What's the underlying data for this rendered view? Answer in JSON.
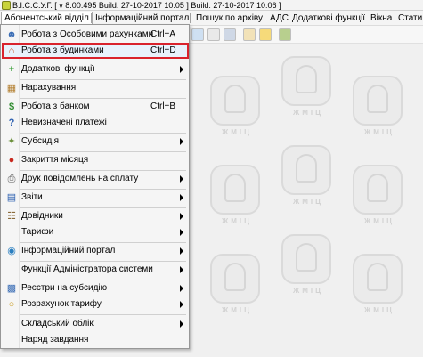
{
  "window": {
    "title": "В.І.С.С.У.Г. [ v 8.00.495 Build: 27-10-2017 10:05 ]   Build: 27-10-2017 10:06 ]"
  },
  "menubar": {
    "items": [
      {
        "label": "Абонентський відділ"
      },
      {
        "label": "Інформаційний портал"
      },
      {
        "label": "Пошук по архіву"
      },
      {
        "label": "АДС"
      },
      {
        "label": "Додаткові функції"
      },
      {
        "label": "Вікна"
      },
      {
        "label": "Стати"
      }
    ]
  },
  "watermark": {
    "text": "ЖМІЦ"
  },
  "dropdown": {
    "items": [
      {
        "label": "Робота з Особовими рахунками",
        "shortcut": "Ctrl+A",
        "icon": "user-accounts-icon",
        "submenu": false
      },
      {
        "label": "Робота з будинками",
        "shortcut": "Ctrl+D",
        "icon": "house-icon",
        "submenu": false
      },
      {
        "label": "Додаткові функції",
        "shortcut": "",
        "icon": "plus-icon",
        "submenu": true
      },
      {
        "label": "Нарахування",
        "shortcut": "",
        "icon": "calculator-icon",
        "submenu": false
      },
      {
        "label": "Робота з банком",
        "shortcut": "Ctrl+B",
        "icon": "dollar-icon",
        "submenu": false
      },
      {
        "label": "Невизначені платежі",
        "shortcut": "",
        "icon": "question-icon",
        "submenu": false
      },
      {
        "label": "Субсидія",
        "shortcut": "",
        "icon": "subsidy-icon",
        "submenu": true
      },
      {
        "label": "Закриття місяця",
        "shortcut": "",
        "icon": "stop-icon",
        "submenu": false
      },
      {
        "label": "Друк повідомлень на сплату",
        "shortcut": "",
        "icon": "printer-icon",
        "submenu": true
      },
      {
        "label": "Звіти",
        "shortcut": "",
        "icon": "report-icon",
        "submenu": true
      },
      {
        "label": "Довідники",
        "shortcut": "",
        "icon": "reference-icon",
        "submenu": true
      },
      {
        "label": "Тарифи",
        "shortcut": "",
        "icon": "",
        "submenu": true
      },
      {
        "label": "Інформаційний портал",
        "shortcut": "",
        "icon": "globe-icon",
        "submenu": true
      },
      {
        "label": "Функції Адміністратора системи",
        "shortcut": "",
        "icon": "",
        "submenu": true
      },
      {
        "label": "Реєстри на субсидію",
        "shortcut": "",
        "icon": "register-icon",
        "submenu": true
      },
      {
        "label": "Розрахунок тарифу",
        "shortcut": "",
        "icon": "coins-icon",
        "submenu": true
      },
      {
        "label": "Складський облік",
        "shortcut": "",
        "icon": "",
        "submenu": true
      },
      {
        "label": "Наряд завдання",
        "shortcut": "",
        "icon": "",
        "submenu": false
      }
    ]
  },
  "colors": {
    "highlight_border": "#d9232d"
  }
}
